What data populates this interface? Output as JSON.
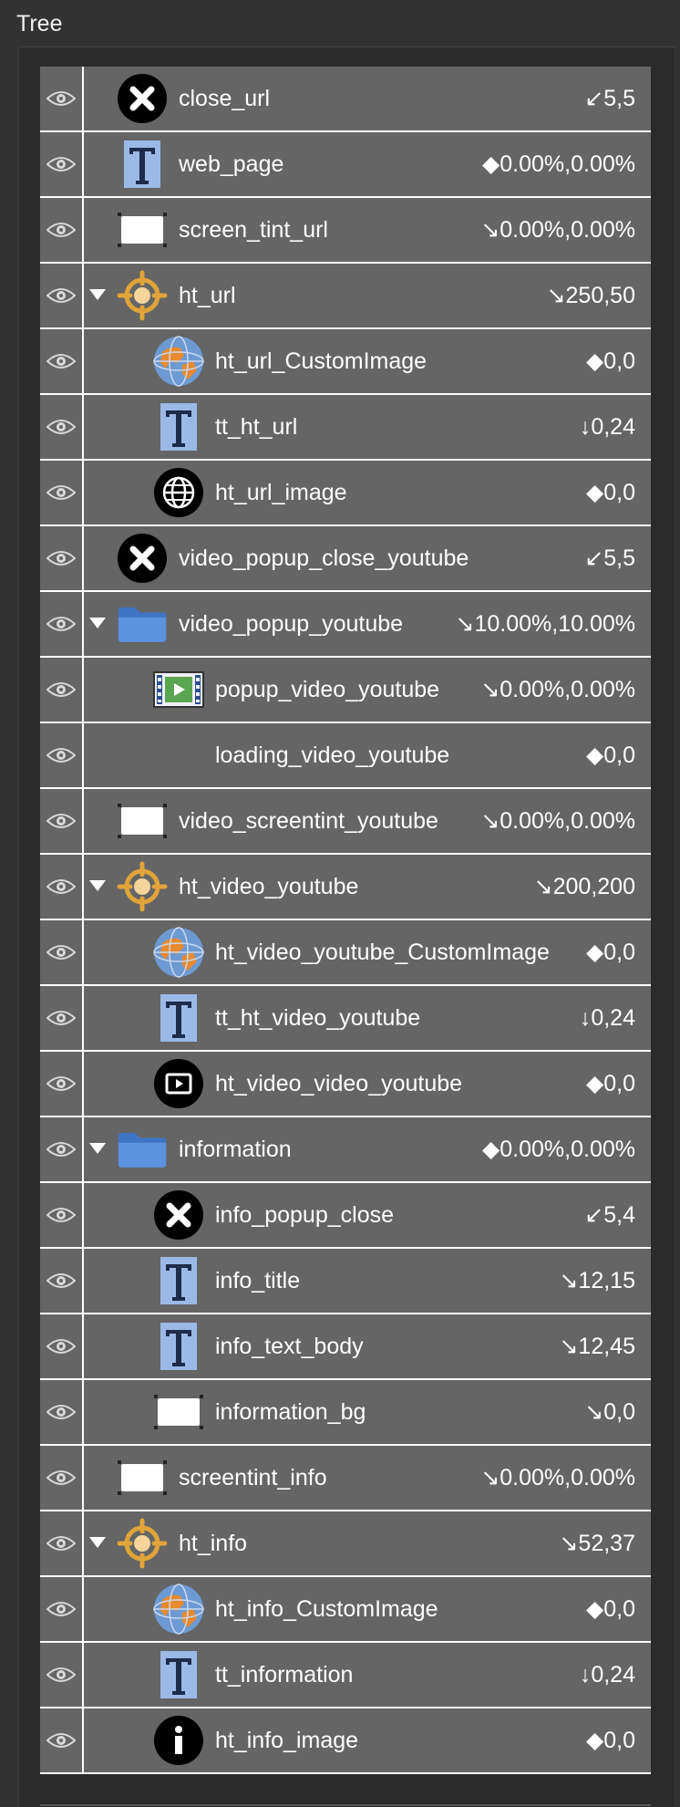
{
  "panel": {
    "title": "Tree"
  },
  "rows": [
    {
      "label": "close_url",
      "value": "↙5,5",
      "icon": "close-x-icon",
      "depth": 0,
      "expand": false
    },
    {
      "label": "web_page",
      "value": "◆0.00%,0.00%",
      "icon": "text-t-icon",
      "depth": 0,
      "expand": false
    },
    {
      "label": "screen_tint_url",
      "value": "↘0.00%,0.00%",
      "icon": "rectangle-icon",
      "depth": 0,
      "expand": false
    },
    {
      "label": "ht_url",
      "value": "↘250,50",
      "icon": "hotspot-crosshair-icon",
      "depth": 0,
      "expand": true
    },
    {
      "label": "ht_url_CustomImage",
      "value": "◆0,0",
      "icon": "globe-image-icon",
      "depth": 1,
      "expand": false
    },
    {
      "label": "tt_ht_url",
      "value": "↓0,24",
      "icon": "text-t-icon",
      "depth": 1,
      "expand": false
    },
    {
      "label": "ht_url_image",
      "value": "◆0,0",
      "icon": "web-globe-icon",
      "depth": 1,
      "expand": false
    },
    {
      "label": "video_popup_close_youtube",
      "value": "↙5,5",
      "icon": "close-x-icon",
      "depth": 0,
      "expand": false
    },
    {
      "label": "video_popup_youtube",
      "value": "↘10.00%,10.00%",
      "icon": "folder-icon",
      "depth": 0,
      "expand": true
    },
    {
      "label": "popup_video_youtube",
      "value": "↘0.00%,0.00%",
      "icon": "video-film-icon",
      "depth": 1,
      "expand": false
    },
    {
      "label": "loading_video_youtube",
      "value": "◆0,0",
      "icon": "none",
      "depth": 1,
      "expand": false
    },
    {
      "label": "video_screentint_youtube",
      "value": "↘0.00%,0.00%",
      "icon": "rectangle-icon",
      "depth": 0,
      "expand": false
    },
    {
      "label": "ht_video_youtube",
      "value": "↘200,200",
      "icon": "hotspot-crosshair-icon",
      "depth": 0,
      "expand": true
    },
    {
      "label": "ht_video_youtube_CustomImage",
      "value": "◆0,0",
      "icon": "globe-image-icon",
      "depth": 1,
      "expand": false
    },
    {
      "label": "tt_ht_video_youtube",
      "value": "↓0,24",
      "icon": "text-t-icon",
      "depth": 1,
      "expand": false
    },
    {
      "label": "ht_video_video_youtube",
      "value": "◆0,0",
      "icon": "video-play-icon",
      "depth": 1,
      "expand": false
    },
    {
      "label": "information",
      "value": "◆0.00%,0.00%",
      "icon": "folder-icon",
      "depth": 0,
      "expand": true
    },
    {
      "label": "info_popup_close",
      "value": "↙5,4",
      "icon": "close-x-icon",
      "depth": 1,
      "expand": false
    },
    {
      "label": "info_title",
      "value": "↘12,15",
      "icon": "text-t-icon",
      "depth": 1,
      "expand": false
    },
    {
      "label": "info_text_body",
      "value": "↘12,45",
      "icon": "text-t-icon",
      "depth": 1,
      "expand": false
    },
    {
      "label": "information_bg",
      "value": "↘0,0",
      "icon": "rectangle-icon",
      "depth": 1,
      "expand": false
    },
    {
      "label": "screentint_info",
      "value": "↘0.00%,0.00%",
      "icon": "rectangle-icon",
      "depth": 0,
      "expand": false
    },
    {
      "label": "ht_info",
      "value": "↘52,37",
      "icon": "hotspot-crosshair-icon",
      "depth": 0,
      "expand": true
    },
    {
      "label": "ht_info_CustomImage",
      "value": "◆0,0",
      "icon": "globe-image-icon",
      "depth": 1,
      "expand": false
    },
    {
      "label": "tt_information",
      "value": "↓0,24",
      "icon": "text-t-icon",
      "depth": 1,
      "expand": false
    },
    {
      "label": "ht_info_image",
      "value": "◆0,0",
      "icon": "info-i-icon",
      "depth": 1,
      "expand": false
    }
  ]
}
